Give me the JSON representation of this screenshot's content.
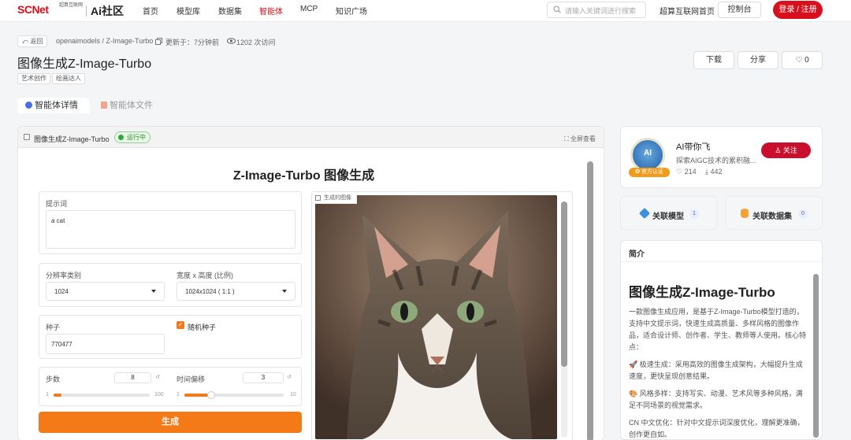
{
  "nav": {
    "logo_text": "SCNet",
    "logo_sub": "超算互联网",
    "logo_ai": "Ai社区",
    "items": [
      {
        "label": "首页"
      },
      {
        "label": "模型库"
      },
      {
        "label": "数据集"
      },
      {
        "label": "智能体",
        "active": true
      },
      {
        "label": "MCP"
      },
      {
        "label": "知识广场"
      }
    ],
    "search_placeholder": "请输入关键词进行搜索",
    "home_link": "超算互联网首页",
    "console": "控制台",
    "login": "登录 / 注册"
  },
  "header": {
    "back": "返回",
    "breadcrumb": "openaimodels / Z-Image-Turbo",
    "updated": "更新于：7分钟前",
    "visits": "1202 次访问",
    "title": "图像生成Z-Image-Turbo",
    "tags": [
      "艺术创作",
      "绘画达人"
    ],
    "download": "下载",
    "share": "分享",
    "likes": "0",
    "tabs": [
      "智能体详情",
      "智能体文件"
    ]
  },
  "app": {
    "panel_title": "图像生成Z-Image-Turbo",
    "status": "运行中",
    "fullview": "全屏查看",
    "heading": "Z-Image-Turbo 图像生成",
    "prompt_label": "提示词",
    "prompt_value": "a cat",
    "resolution_label": "分辨率类别",
    "resolution_value": "1024",
    "size_label": "宽度 x 高度 (比例)",
    "size_value": "1024x1024 ( 1:1 )",
    "seed_label": "种子",
    "seed_value": "770477",
    "random_seed_label": "随机种子",
    "random_seed_checked": true,
    "steps_label": "步数",
    "steps_value": "8",
    "steps_min": "1",
    "steps_max": "100",
    "shift_label": "时间偏移",
    "shift_value": "3",
    "shift_min": "1",
    "shift_max": "10",
    "generate": "生成",
    "image_label": "生成的图像"
  },
  "author": {
    "name": "AI带你飞",
    "badge": "官方认证",
    "desc": "探索AIGC技术的累积融...",
    "followers": "214",
    "downloads": "442",
    "follow": "关注"
  },
  "related": {
    "models_label": "关联模型",
    "models_count": "1",
    "datasets_label": "关联数据集",
    "datasets_count": "0"
  },
  "intro": {
    "head": "简介",
    "title": "图像生成Z-Image-Turbo",
    "p1": "一款图像生成应用，是基于Z-Image-Turbo模型打造的，支持中文提示词，快速生成高质量、多样风格的图像作品，适合设计师、创作者、学生、教师等人使用。核心特点：",
    "p2": "🚀 极速生成：采用高效的图像生成架构，大幅提升生成速度，更快呈现创意结果。",
    "p3": "🎨 风格多样：支持写实、动漫、艺术风等多种风格，满足不同场景的视觉需求。",
    "p4": "CN 中文优化：针对中文提示词深度优化，理解更准确，创作更自如。"
  },
  "colors": {
    "brand_red": "#d6101c",
    "accent_orange": "#f47a17",
    "running_green": "#2faa35"
  }
}
